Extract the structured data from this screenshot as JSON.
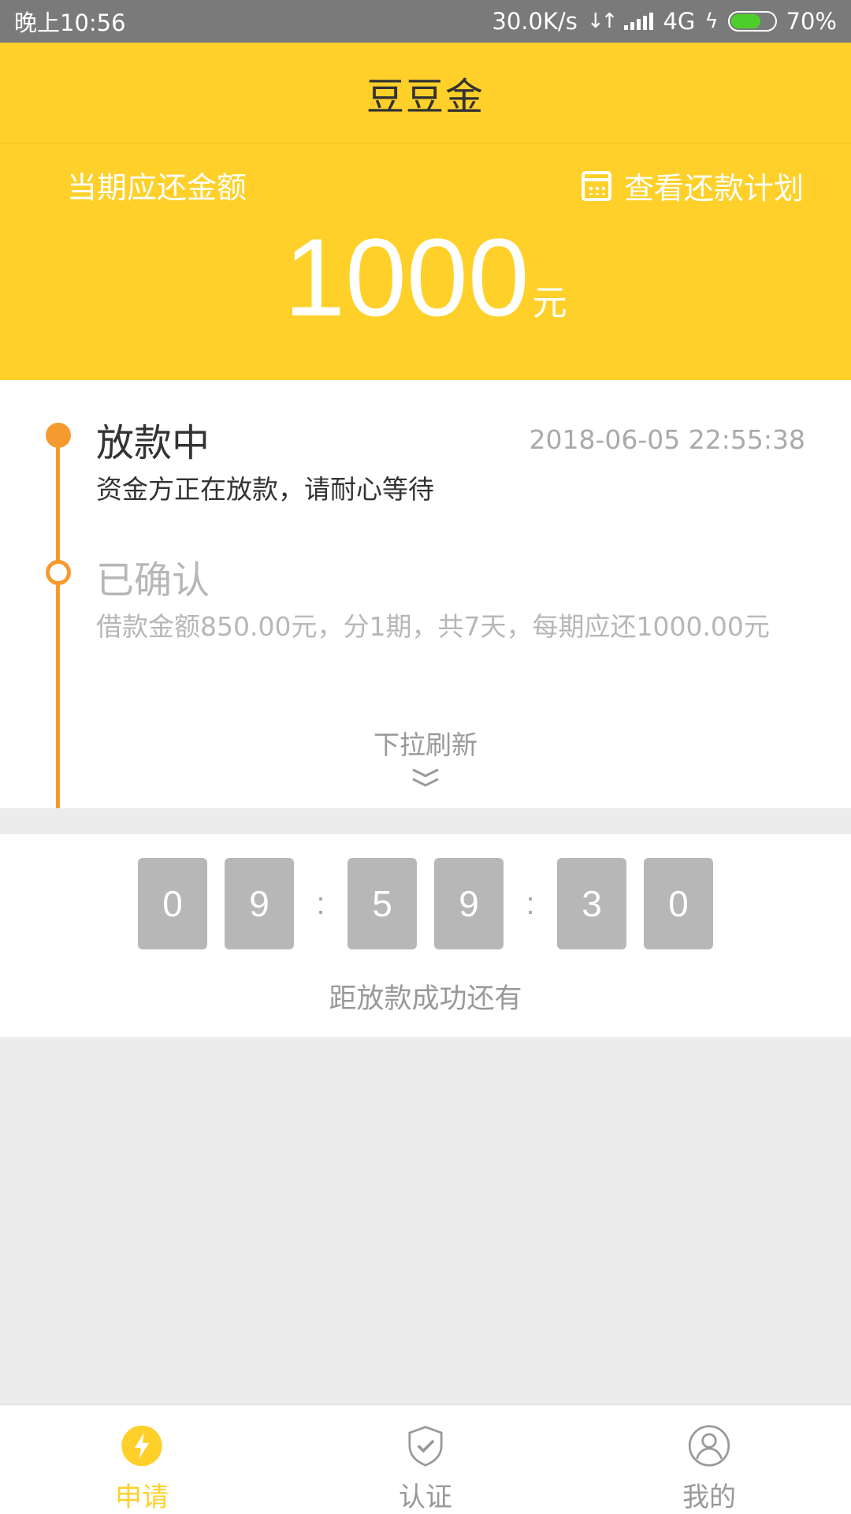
{
  "status_bar": {
    "time": "晚上10:56",
    "network_speed": "30.0K/s",
    "network_type": "4G",
    "battery": "70%",
    "battery_level": 0.7,
    "battery_color": "#4ccf2b"
  },
  "header": {
    "title": "豆豆金"
  },
  "amount_panel": {
    "label": "当期应还金额",
    "plan_link": "查看还款计划",
    "amount": "1000",
    "unit": "元"
  },
  "timeline": {
    "steps": [
      {
        "title": "放款中",
        "time": "2018-06-05 22:55:38",
        "desc": "资金方正在放款，请耐心等待"
      },
      {
        "title": "已确认",
        "desc": "借款金额850.00元，分1期，共7天，每期应还1000.00元"
      }
    ],
    "refresh_hint": "下拉刷新"
  },
  "countdown": {
    "digits": [
      "0",
      "9",
      "5",
      "9",
      "3",
      "0"
    ],
    "separator": ":",
    "label": "距放款成功还有"
  },
  "bottom_nav": {
    "items": [
      {
        "label": "申请",
        "icon": "lightning-icon",
        "active": true
      },
      {
        "label": "认证",
        "icon": "shield-check-icon",
        "active": false
      },
      {
        "label": "我的",
        "icon": "user-icon",
        "active": false
      }
    ]
  },
  "colors": {
    "brand_yellow": "#fed029",
    "timeline_orange": "#f59a2f",
    "inactive_gray": "#b7b7b7"
  }
}
